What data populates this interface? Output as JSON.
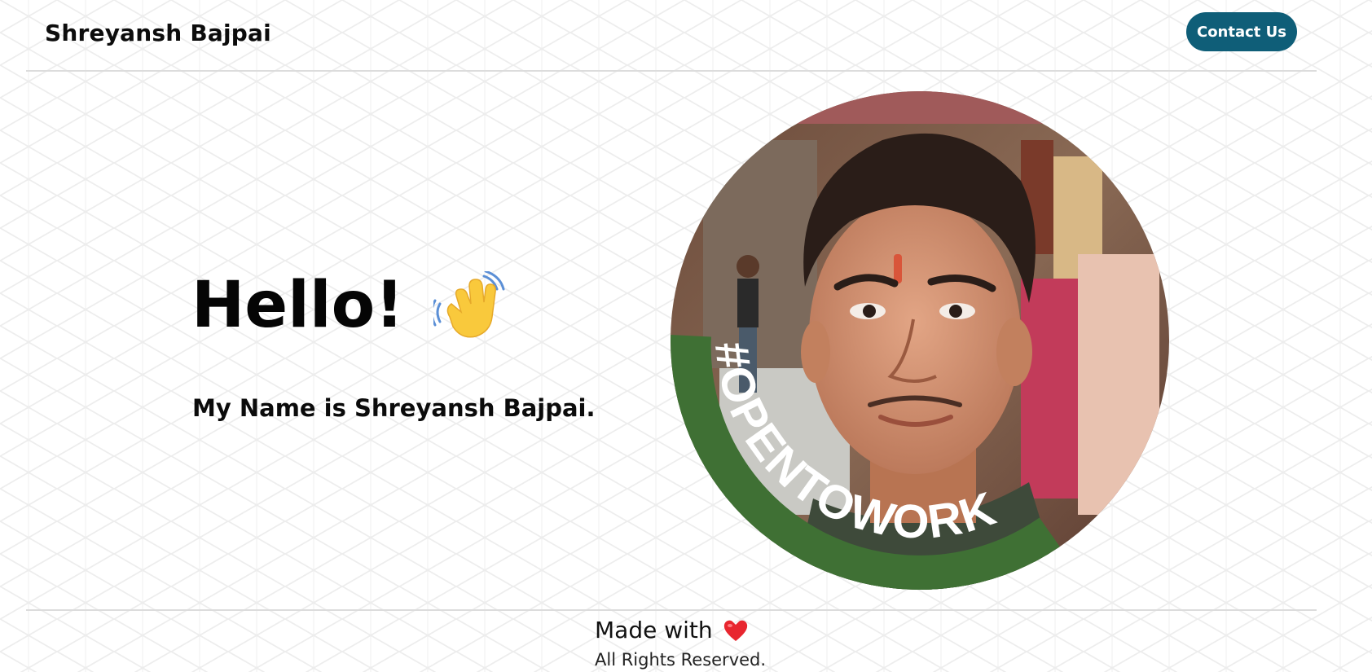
{
  "header": {
    "brand": "Shreyansh Bajpai",
    "contact_label": "Contact Us"
  },
  "hero": {
    "greeting": "Hello!",
    "greeting_icon": "waving-hand-icon",
    "intro": "My Name is Shreyansh Bajpai."
  },
  "avatar": {
    "badge_text": "#OPENTOWORK",
    "badge_color": "#3f7034"
  },
  "footer": {
    "made_with": "Made with",
    "heart_icon": "heart-icon",
    "rights": "All Rights Reserved."
  },
  "colors": {
    "accent": "#0f5e78",
    "divider": "#dcdcdc"
  }
}
